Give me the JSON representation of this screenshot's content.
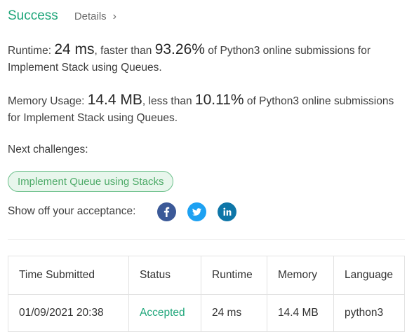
{
  "header": {
    "title": "Success",
    "details_label": "Details",
    "chevron": "›"
  },
  "runtime": {
    "label": "Runtime: ",
    "value": "24 ms",
    "middle": ", faster than ",
    "percent": "93.26%",
    "tail": " of Python3 online submissions for Implement Stack using Queues."
  },
  "memory": {
    "label": "Memory Usage: ",
    "value": "14.4 MB",
    "middle": ", less than ",
    "percent": "10.11%",
    "tail": " of Python3 online submissions for Implement Stack using Queues."
  },
  "next_challenges": {
    "label": "Next challenges:",
    "items": [
      "Implement Queue using Stacks"
    ]
  },
  "share": {
    "label": "Show off your acceptance:",
    "icons": [
      "facebook-icon",
      "twitter-icon",
      "linkedin-icon"
    ]
  },
  "table": {
    "headers": [
      "Time Submitted",
      "Status",
      "Runtime",
      "Memory",
      "Language"
    ],
    "rows": [
      [
        "01/09/2021 20:38",
        "Accepted",
        "24 ms",
        "14.4 MB",
        "python3"
      ]
    ]
  },
  "colors": {
    "accent": "#1fa67a",
    "chip_bg": "#e8f6ec",
    "chip_text": "#4daa68",
    "facebook": "#3b5998",
    "twitter": "#1da1f2",
    "linkedin": "#0e76a8"
  }
}
